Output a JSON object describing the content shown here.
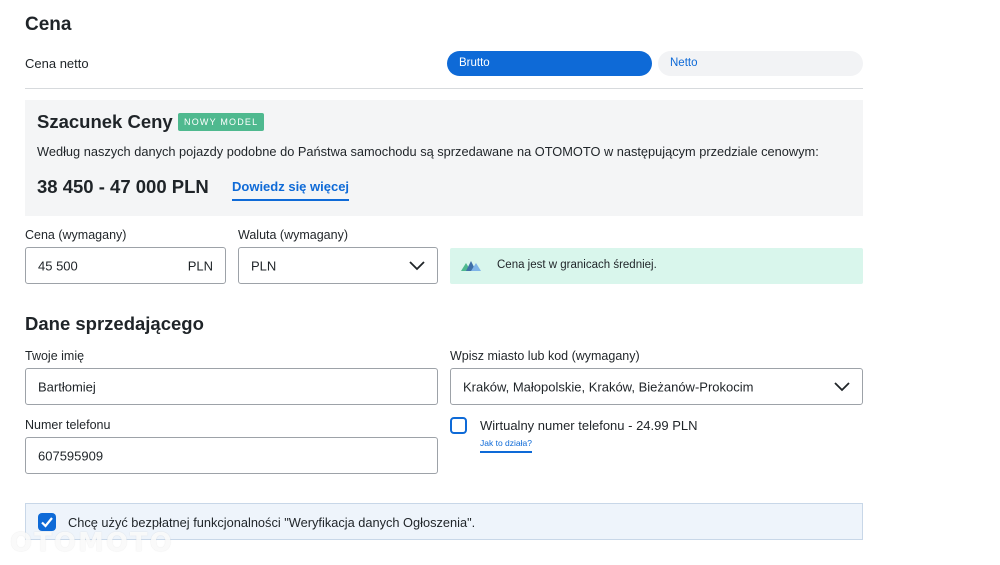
{
  "price_section": {
    "title": "Cena",
    "net_price_label": "Cena netto",
    "toggle": {
      "gross": "Brutto",
      "net": "Netto",
      "selected": "gross"
    }
  },
  "estimate": {
    "title": "Szacunek Ceny",
    "badge": "NOWY MODEL",
    "description": "Według naszych danych pojazdy podobne do Państwa samochodu są sprzedawane na OTOMOTO w następującym przedziale cenowym:",
    "range": "38 450 - 47 000 PLN",
    "link": "Dowiedz się więcej"
  },
  "price_fields": {
    "price_label": "Cena (wymagany)",
    "price_value": "45 500",
    "price_suffix": "PLN",
    "currency_label": "Waluta (wymagany)",
    "currency_value": "PLN",
    "info_text": "Cena jest w granicach średniej."
  },
  "seller": {
    "title": "Dane sprzedającego",
    "name_label": "Twoje imię",
    "name_value": "Bartłomiej",
    "city_label": "Wpisz miasto lub kod (wymagany)",
    "city_value": "Kraków, Małopolskie, Kraków, Bieżanów-Prokocim",
    "phone_label": "Numer telefonu",
    "phone_value": "607595909",
    "virtual_number_label": "Wirtualny numer telefonu - 24.99 PLN",
    "virtual_number_checked": false,
    "how_it_works_link": "Jak to działa?"
  },
  "verification": {
    "label": "Chcę użyć bezpłatnej funkcjonalności \"Weryfikacja danych Ogłoszenia\".",
    "checked": true
  },
  "watermark": "OTOMOTO",
  "colors": {
    "accent": "#0e6ad7",
    "badge": "#4fb98f",
    "info_banner": "#d9f6ec",
    "estimate_bg": "#f4f5f6"
  }
}
